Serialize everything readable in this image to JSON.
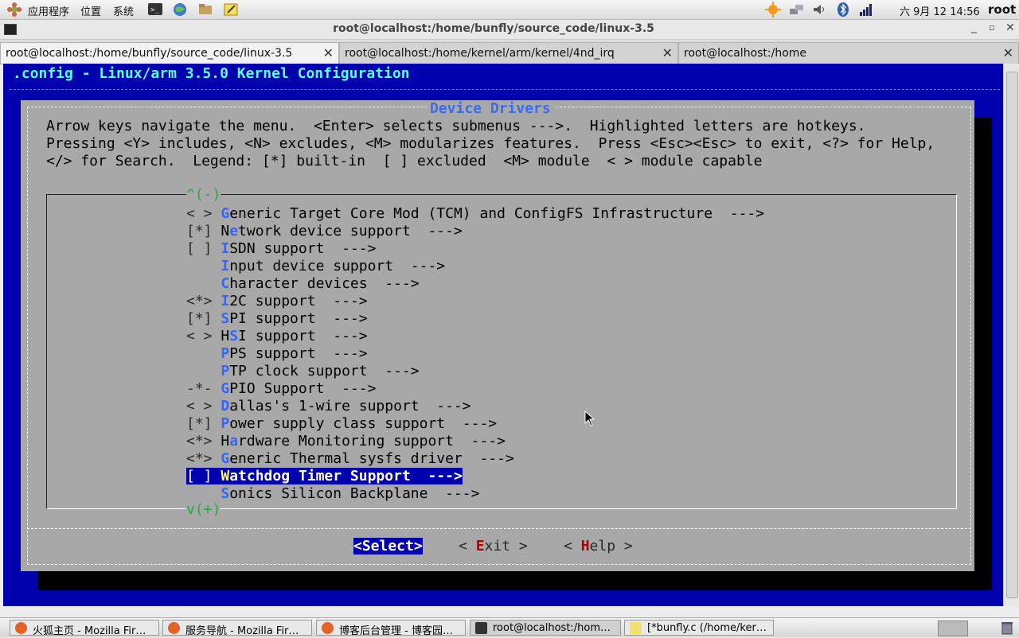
{
  "panel": {
    "menu_apps": "应用程序",
    "menu_places": "位置",
    "menu_system": "系统",
    "clock": "六 9月 12 14:56",
    "user": "root",
    "launchers": [
      "terminal-icon",
      "browser-icon",
      "file-manager-icon",
      "text-editor-icon"
    ],
    "tray": [
      "update-icon",
      "network-icon",
      "volume-icon",
      "bluetooth-icon",
      "signal-icon"
    ]
  },
  "window": {
    "title": "root@localhost:/home/bunfly/source_code/linux-3.5",
    "tabs": [
      {
        "label": "root@localhost:/home/bunfly/source_code/linux-3.5"
      },
      {
        "label": "root@localhost:/home/kernel/arm/kernel/4nd_irq"
      },
      {
        "label": "root@localhost:/home"
      }
    ]
  },
  "terminal": {
    "header": ".config - Linux/arm 3.5.0 Kernel Configuration",
    "dialog_title": "Device Drivers",
    "help_lines": [
      "Arrow keys navigate the menu.  <Enter> selects submenus --->.  Highlighted letters are hotkeys.",
      "Pressing <Y> includes, <N> excludes, <M> modularizes features.  Press <Esc><Esc> to exit, <?> for Help,",
      "</> for Search.  Legend: [*] built-in  [ ] excluded  <M> module  < > module capable"
    ],
    "scroll_up": "^(-)",
    "scroll_down": "v(+)",
    "items": [
      {
        "prefix": "< > ",
        "hot": "G",
        "rest": "eneric Target Core Mod (TCM) and ConfigFS Infrastructure  --->"
      },
      {
        "prefix": "[*] ",
        "pre": "N",
        "hot": "e",
        "rest": "twork device support  --->"
      },
      {
        "prefix": "[ ] ",
        "hot": "I",
        "rest": "SDN support  --->"
      },
      {
        "prefix": "    ",
        "hot": "I",
        "rest": "nput device support  --->"
      },
      {
        "prefix": "    ",
        "hot": "C",
        "rest": "haracter devices  --->"
      },
      {
        "prefix": "<*> ",
        "hot": "I",
        "rest": "2C support  --->"
      },
      {
        "prefix": "[*] ",
        "hot": "S",
        "rest": "PI support  --->"
      },
      {
        "prefix": "< > ",
        "pre": "H",
        "hot": "S",
        "rest": "I support  --->"
      },
      {
        "prefix": "    ",
        "hot": "P",
        "rest": "PS support  --->"
      },
      {
        "prefix": "    ",
        "hot": "P",
        "rest": "TP clock support  --->"
      },
      {
        "prefix": "-*- ",
        "hot": "G",
        "rest": "PIO Support  --->"
      },
      {
        "prefix": "< > ",
        "hot": "D",
        "rest": "allas's 1-wire support  --->"
      },
      {
        "prefix": "[*] ",
        "hot": "P",
        "rest": "ower supply class support  --->"
      },
      {
        "prefix": "<*> ",
        "pre": "H",
        "hot": "a",
        "rest": "rdware Monitoring support  --->"
      },
      {
        "prefix": "<*> ",
        "hot": "G",
        "rest": "eneric Thermal sysfs driver  --->"
      },
      {
        "prefix": "[ ] ",
        "hot": "W",
        "rest": "atchdog Timer Support  --->",
        "selected": true
      },
      {
        "prefix": "    ",
        "hot": "S",
        "rest": "onics Silicon Backplane  --->"
      }
    ],
    "buttons": {
      "select": "<Select>",
      "exit_pre": "< ",
      "exit_hot": "E",
      "exit_rest": "xit >",
      "help_pre": "< ",
      "help_hot": "H",
      "help_rest": "elp >"
    }
  },
  "taskbar": {
    "items": [
      {
        "label": "火狐主页 - Mozilla Fir…",
        "icon": "firefox-icon"
      },
      {
        "label": "服务导航 - Mozilla Fir…",
        "icon": "firefox-icon"
      },
      {
        "label": "博客后台管理 - 博客园…",
        "icon": "firefox-icon"
      },
      {
        "label": "root@localhost:/hom…",
        "icon": "terminal-icon"
      },
      {
        "label": "[*bunfly.c (/home/ker…",
        "icon": "text-editor-icon"
      }
    ]
  },
  "colors": {
    "terminal_bg": "#0000ac",
    "dialog_bg": "#a8a8a8",
    "hotkey": "#3366ff",
    "selected_bg": "#0000ac",
    "header_text": "#55ffff"
  }
}
